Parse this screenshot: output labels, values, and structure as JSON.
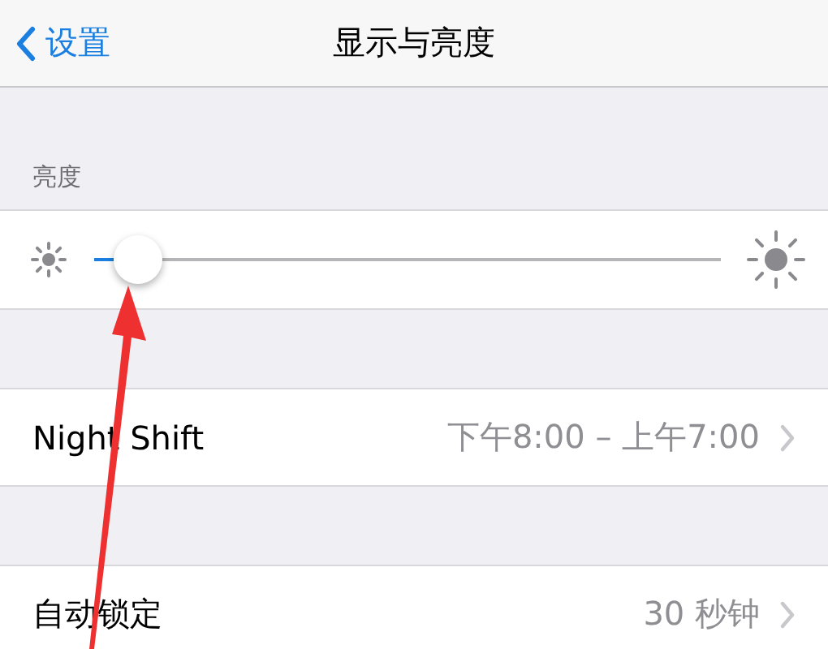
{
  "nav_bar": {
    "back": "设置",
    "title": "显示与亮度"
  },
  "sections": [
    {
      "kind": "slider",
      "header": "亮度",
      "level": 0.07
    },
    {
      "kind": "rows",
      "rows": [
        {
          "label": "Night Shift",
          "value": "下午8:00 – 上午7:00"
        }
      ]
    },
    {
      "kind": "rows",
      "rows": [
        {
          "label": "自动锁定",
          "value": "30 秒钟"
        }
      ]
    }
  ]
}
